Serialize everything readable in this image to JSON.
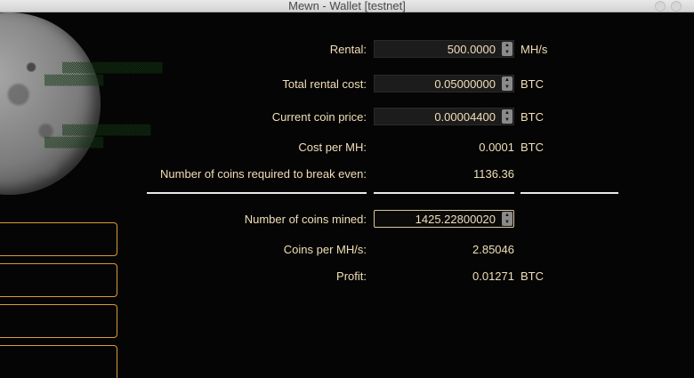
{
  "window": {
    "title": "Mewn - Wallet [testnet]"
  },
  "form": {
    "rental": {
      "label": "Rental:",
      "value": "500.0000",
      "unit": "MH/s"
    },
    "total_rental_cost": {
      "label": "Total rental cost:",
      "value": "0.05000000",
      "unit": "BTC"
    },
    "current_coin_price": {
      "label": "Current coin price:",
      "value": "0.00004400",
      "unit": "BTC"
    },
    "cost_per_mh": {
      "label": "Cost per MH:",
      "value": "0.0001",
      "unit": "BTC"
    },
    "coins_break_even": {
      "label": "Number of coins required to break even:",
      "value": "1136.36"
    },
    "coins_mined": {
      "label": "Number of coins mined:",
      "value": "1425.22800020"
    },
    "coins_per_mhs": {
      "label": "Coins per MH/s:",
      "value": "2.85046"
    },
    "profit": {
      "label": "Profit:",
      "value": "0.01271",
      "unit": "BTC"
    }
  },
  "icons": {
    "spin_up": "▲",
    "spin_down": "▼"
  },
  "colors": {
    "text": "#f2dfb8",
    "accent_border": "#d99a3a",
    "background": "#050505"
  }
}
